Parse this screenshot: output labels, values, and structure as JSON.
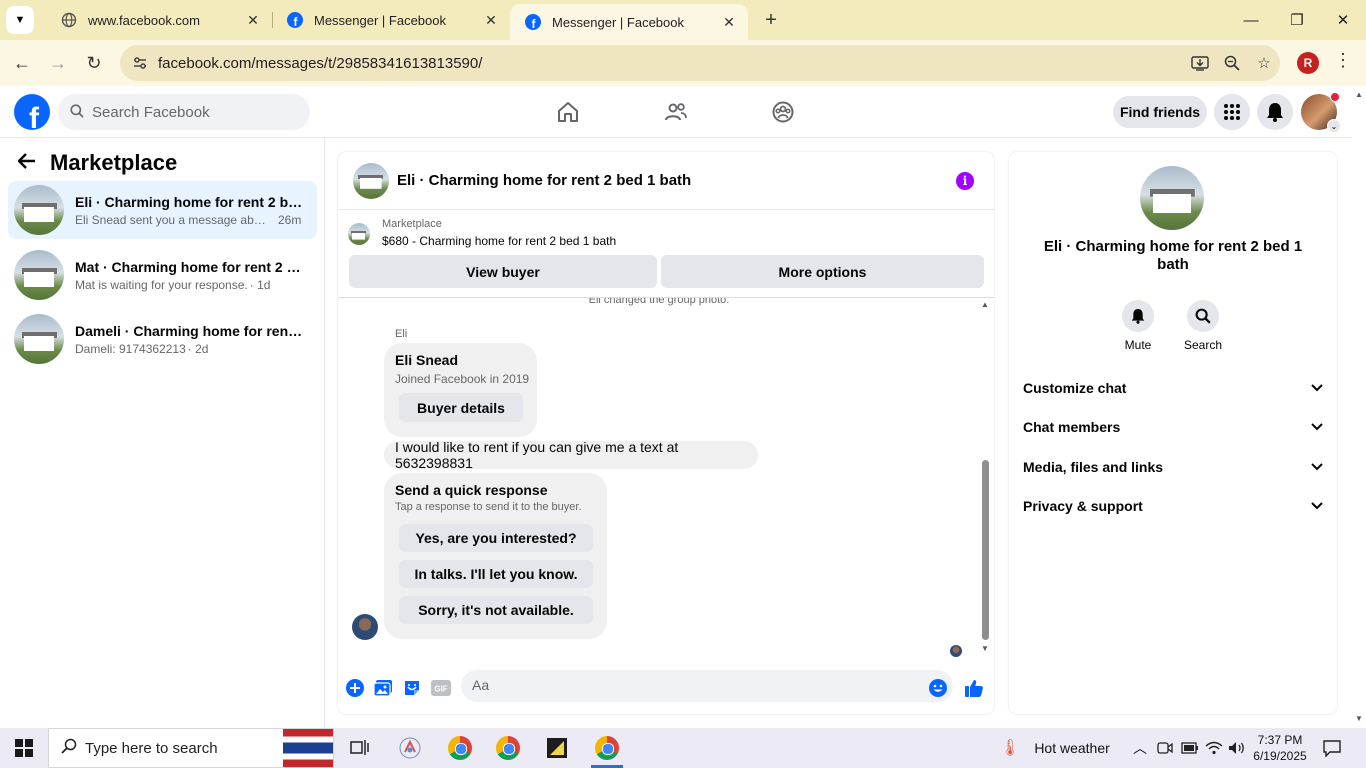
{
  "browser": {
    "tabs": [
      {
        "title": "www.facebook.com",
        "active": false
      },
      {
        "title": "Messenger | Facebook",
        "active": false
      },
      {
        "title": "Messenger | Facebook",
        "active": true
      }
    ],
    "url": "facebook.com/messages/t/29858341613813590/",
    "profile_initial": "R"
  },
  "fb": {
    "search_placeholder": "Search Facebook",
    "find_friends": "Find friends"
  },
  "left": {
    "title": "Marketplace",
    "conversations": [
      {
        "name": "Eli · Charming home for rent 2 bed...",
        "preview": "Eli Snead sent you a message about...",
        "time": "26m",
        "selected": true
      },
      {
        "name": "Mat · Charming home for rent 2 b...",
        "preview": "Mat is waiting for your response.",
        "time": "· 1d",
        "selected": false
      },
      {
        "name": "Dameli · Charming home for rent ...",
        "preview": "Dameli: 9174362213",
        "time": "· 2d",
        "selected": false
      }
    ]
  },
  "chat": {
    "title": "Eli · Charming home for rent 2 bed 1 bath",
    "marketplace_label": "Marketplace",
    "listing": "$680 - Charming home for rent 2 bed 1 bath",
    "view_buyer": "View buyer",
    "more_options": "More options",
    "system_message": "Eli changed the group photo.",
    "sender": "Eli",
    "card": {
      "name": "Eli Snead",
      "joined": "Joined Facebook in 2019",
      "button": "Buyer details"
    },
    "message": "I would like to rent if you can give me a text at 5632398831",
    "quick": {
      "title": "Send a quick response",
      "subtitle": "Tap a response to send it to the buyer.",
      "options": [
        "Yes, are you interested?",
        "In talks. I'll let you know.",
        "Sorry, it's not available."
      ]
    },
    "composer_placeholder": "Aa"
  },
  "right": {
    "title": "Eli · Charming home for rent 2 bed 1 bath",
    "mute": "Mute",
    "search": "Search",
    "sections": [
      "Customize chat",
      "Chat members",
      "Media, files and links",
      "Privacy & support"
    ]
  },
  "taskbar": {
    "search_placeholder": "Type here to search",
    "weather": "Hot weather",
    "time": "7:37 PM",
    "date": "6/19/2025"
  }
}
